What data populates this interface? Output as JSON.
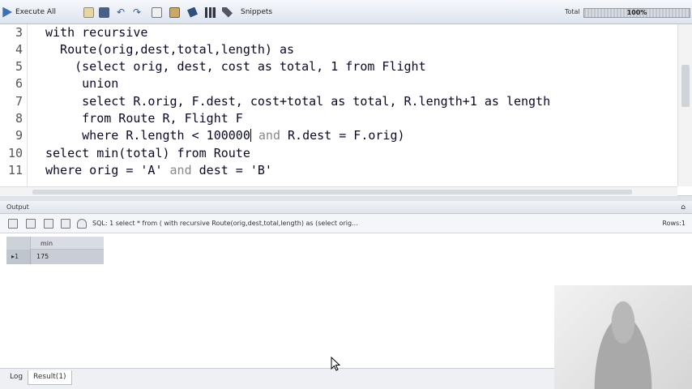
{
  "toolbar": {
    "execute_label": "Execute All",
    "snippets_label": "Snippets",
    "total_label": "Total",
    "progress_text": "100%",
    "progress_value": 1.0
  },
  "editor": {
    "lines": [
      {
        "num": "3",
        "text": "with recursive"
      },
      {
        "num": "4",
        "text": "  Route(orig,dest,total,length) as"
      },
      {
        "num": "5",
        "text": "    (select orig, dest, cost as total, 1 from Flight"
      },
      {
        "num": "6",
        "text": "     union"
      },
      {
        "num": "7",
        "text": "     select R.orig, F.dest, cost+total as total, R.length+1 as length"
      },
      {
        "num": "8",
        "text": "     from Route R, Flight F"
      },
      {
        "num": "9",
        "text_before_caret": "     where R.length < 100000",
        "text_and": "and",
        "text_after": " R.dest = F.orig)"
      },
      {
        "num": "10",
        "text": "select min(total) from Route"
      },
      {
        "num": "11",
        "text_start": "where orig = 'A' ",
        "text_and": "and",
        "text_end": " dest = 'B'"
      }
    ]
  },
  "output": {
    "title": "Output",
    "pin": "⌂",
    "sql_text": "SQL: 1 select * from (     with recursive    Route(orig,dest,total,length) as      (select orig...",
    "rows_text": "Rows:1"
  },
  "grid": {
    "column": "min",
    "row_marker": "▸1",
    "value": "175"
  },
  "tabs": {
    "log": "Log",
    "result": "Result(1)"
  }
}
